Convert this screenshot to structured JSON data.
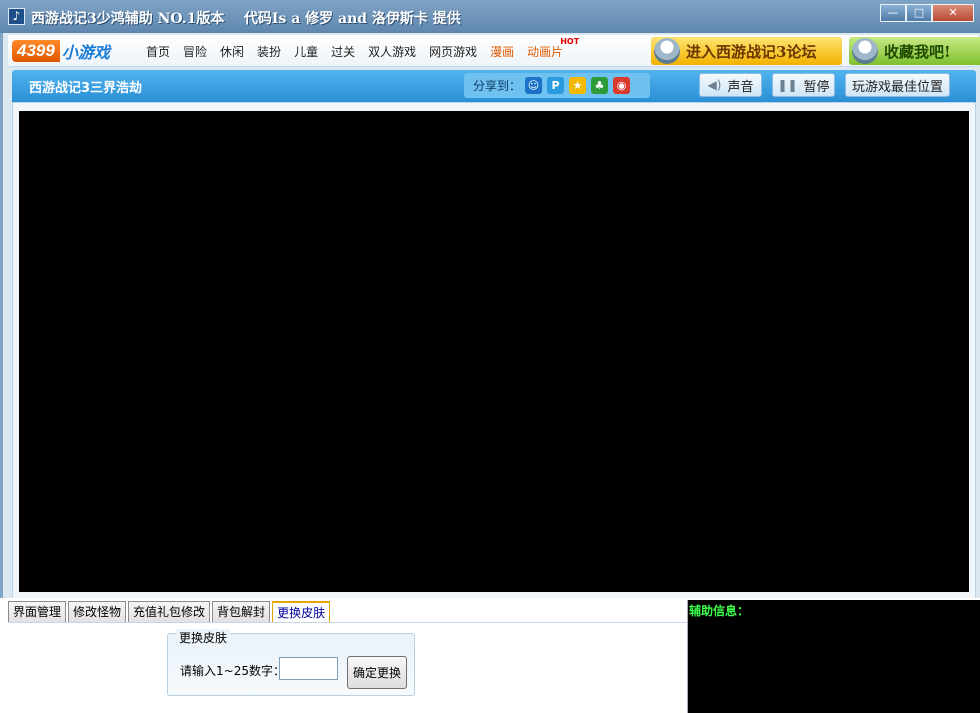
{
  "window": {
    "title": "西游战记3少鸿辅助 NO.1版本    代码Is a 修罗 and 洛伊斯卡 提供",
    "minimize": "—",
    "maximize": "□",
    "close": "✕"
  },
  "site": {
    "logo_number": "4399",
    "logo_text": "小游戏",
    "nav": [
      "首页",
      "冒险",
      "休闲",
      "装扮",
      "儿童",
      "过关",
      "双人游戏",
      "网页游戏",
      "漫画",
      "动画片"
    ],
    "hot_badge": "HOT",
    "forum_banner": "进入西游战记3论坛",
    "favorite_banner": "收藏我吧!"
  },
  "game_bar": {
    "title": "西游战记3三界浩劫",
    "share_label": "分享到：",
    "share_icons": [
      "qq-icon",
      "qzone-icon",
      "star-icon",
      "clover-icon",
      "weibo-icon"
    ],
    "sound_label": "声音",
    "pause_label": "暂停",
    "best_position_label": "玩游戏最佳位置"
  },
  "tabs": [
    "界面管理",
    "修改怪物",
    "充值礼包修改",
    "背包解封",
    "更换皮肤"
  ],
  "active_tab": "更换皮肤",
  "skin_panel": {
    "group_title": "更换皮肤",
    "input_label": "请输入1~25数字：",
    "input_value": "",
    "confirm_label": "确定更换"
  },
  "info_panel": {
    "label": "辅助信息："
  },
  "colors": {
    "titlebar": "#6f95bb",
    "game_bar": "#3a9fe2",
    "info_text": "#3cff4a",
    "active_tab_text": "#00009a"
  }
}
